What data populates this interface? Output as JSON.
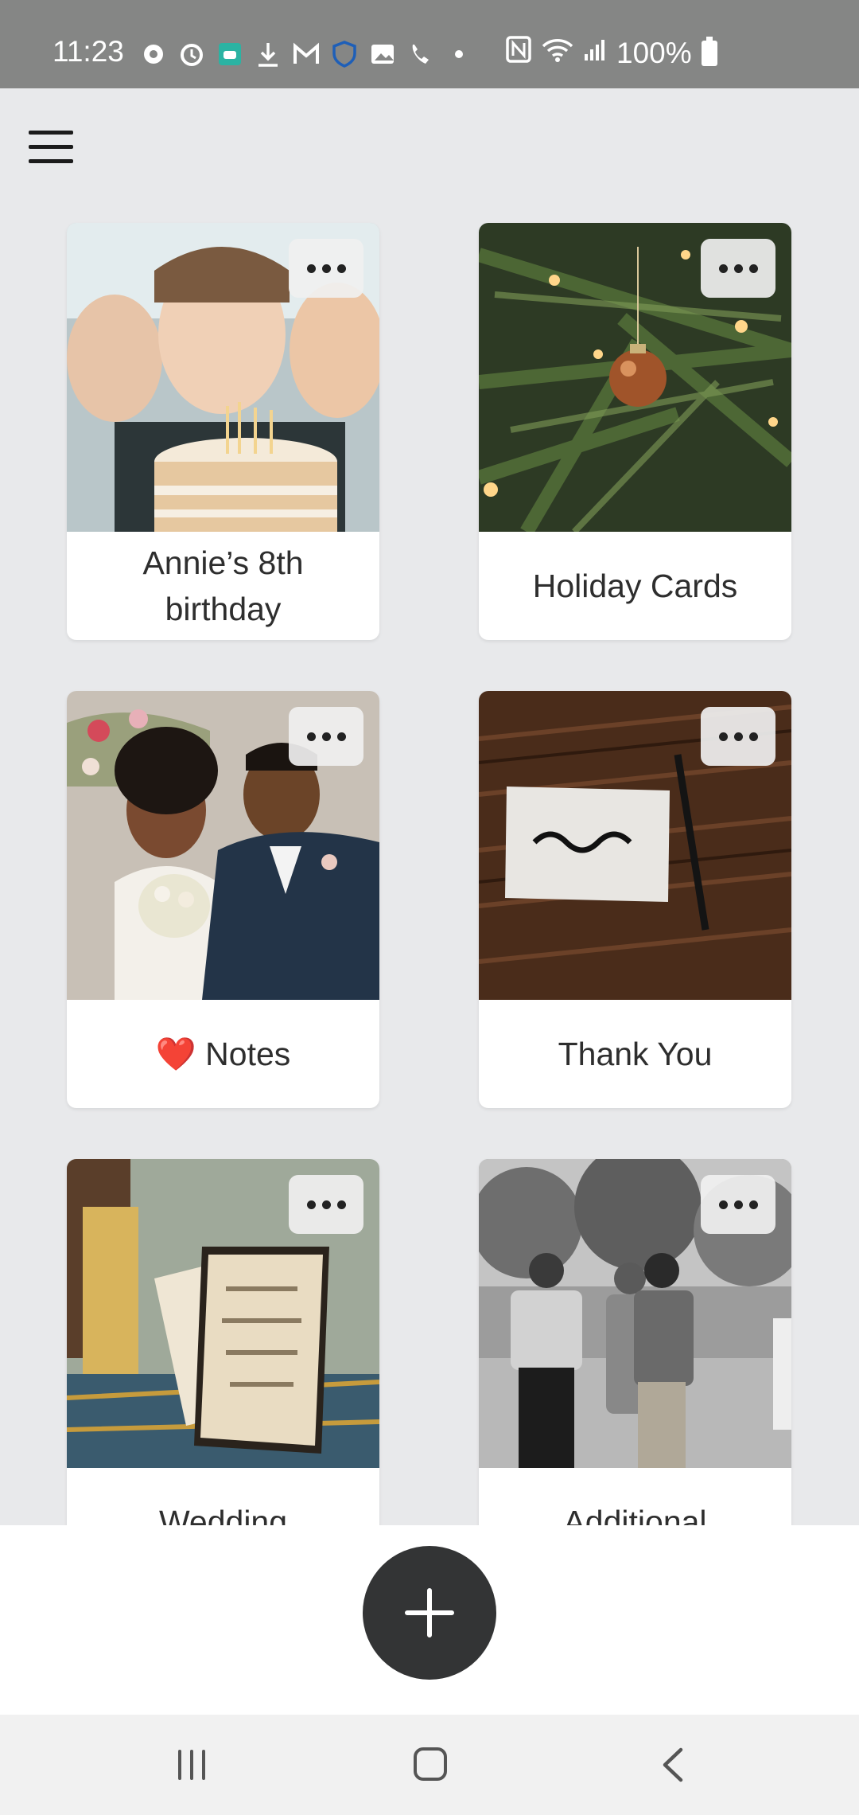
{
  "status_bar": {
    "time": "11:23",
    "battery": "100%",
    "icons": [
      "settings-icon",
      "alarm-icon",
      "android-icon",
      "download-icon",
      "gmail-icon",
      "shield-icon",
      "gallery-icon",
      "wifi-calling-icon",
      "dot-icon"
    ],
    "right_icons": [
      "nfc-icon",
      "wifi-icon",
      "signal-icon",
      "battery-icon"
    ]
  },
  "header": {
    "menu_icon": "hamburger-menu-icon"
  },
  "cards": [
    {
      "title": "Annie’s 8th birthday",
      "image": "children blowing out birthday cake candles"
    },
    {
      "title": "Holiday Cards",
      "image": "christmas tree ornament"
    },
    {
      "title": "❤️ Notes",
      "image": "couple at wedding"
    },
    {
      "title": "Thank You",
      "image": "thanks card on wooden table"
    },
    {
      "title": "Wedding",
      "image": "wedding invitation on table"
    },
    {
      "title": "Additional",
      "image": "black and white group of people outdoors"
    }
  ],
  "fab": {
    "icon": "plus-icon"
  },
  "nav": {
    "icons": [
      "recents-icon",
      "home-icon",
      "back-icon"
    ]
  },
  "colors": {
    "status_bar": "#858685",
    "background": "#e8e9eb",
    "fab": "#333435"
  }
}
